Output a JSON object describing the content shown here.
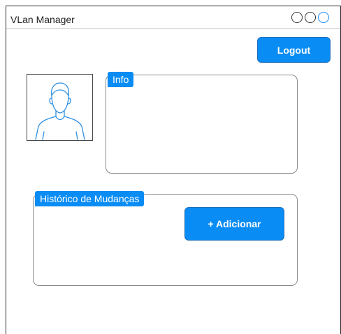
{
  "window": {
    "title": "VLan Manager"
  },
  "toolbar": {
    "logout_label": "Logout"
  },
  "info_panel": {
    "tab_label": "Info"
  },
  "history_panel": {
    "tab_label": "Histórico de  Mudanças",
    "add_label": "+ Adicionar"
  },
  "colors": {
    "accent": "#0a8cf5",
    "avatar_stroke": "#2f8fe0"
  }
}
